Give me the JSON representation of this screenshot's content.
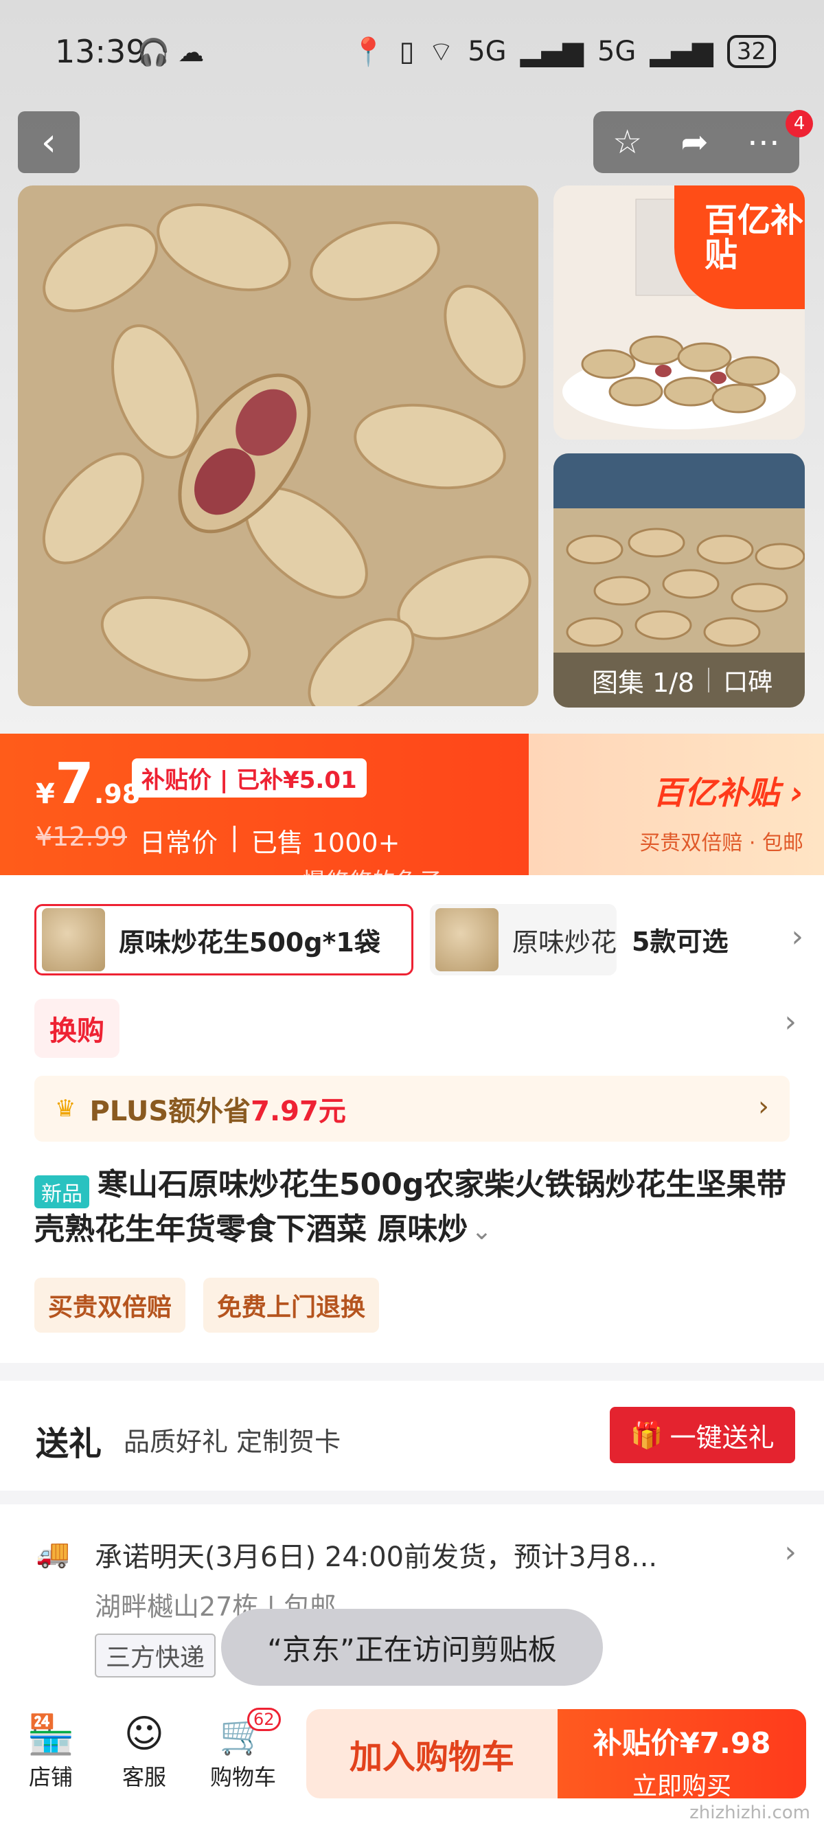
{
  "status_bar": {
    "time": "13:39",
    "network_1": "5G",
    "network_2": "5G",
    "battery": "32"
  },
  "gallery": {
    "subsidy_corner_text": "百亿补贴",
    "album_label": "图集 1/8",
    "review_label": "口碑",
    "notification_count": "4"
  },
  "price": {
    "currency": "¥",
    "integer": "7",
    "decimal": ".98",
    "tag": "补贴价 | 已补¥5.01",
    "old_price": "¥12.99",
    "old_price_label": "日常价",
    "sold": "已售 1000+",
    "brand_title": "百亿补贴",
    "brand_sub": "买贵双倍赔 · 包邮",
    "watermark_name": "慢悠悠的兔子"
  },
  "specs": {
    "selected": "原味炒花生500g*1袋",
    "other": "原味炒花生",
    "count": "5款可选"
  },
  "exchange_label": "换购",
  "plus": {
    "label": "PLUS额外省",
    "amount": "7.97元"
  },
  "product": {
    "badge": "新品",
    "title": "寒山石原味炒花生500g农家柴火铁锅炒花生坚果带壳熟花生年货零食下酒菜 原味炒"
  },
  "service_tags": [
    "买贵双倍赔",
    "免费上门退换"
  ],
  "gift": {
    "title": "送礼",
    "subtitle": "品质好礼 定制贺卡",
    "button": "一键送礼"
  },
  "delivery": {
    "line1": "承诺明天(3月6日) 24:00前发货，预计3月8...",
    "line2": "湖畔樾山27栋 | 包邮",
    "express": "三方快递"
  },
  "toast": "“京东”正在访问剪贴板",
  "bottom_bar": {
    "shop": "店铺",
    "service": "客服",
    "cart": "购物车",
    "cart_count": "62",
    "add_to_cart": "加入购物车",
    "buy_price": "补贴价¥7.98",
    "buy_label": "立即购买"
  },
  "site_watermark": "zhizhizhi.com",
  "colors": {
    "accent_red": "#e4232f",
    "orange": "#ff4d17"
  }
}
